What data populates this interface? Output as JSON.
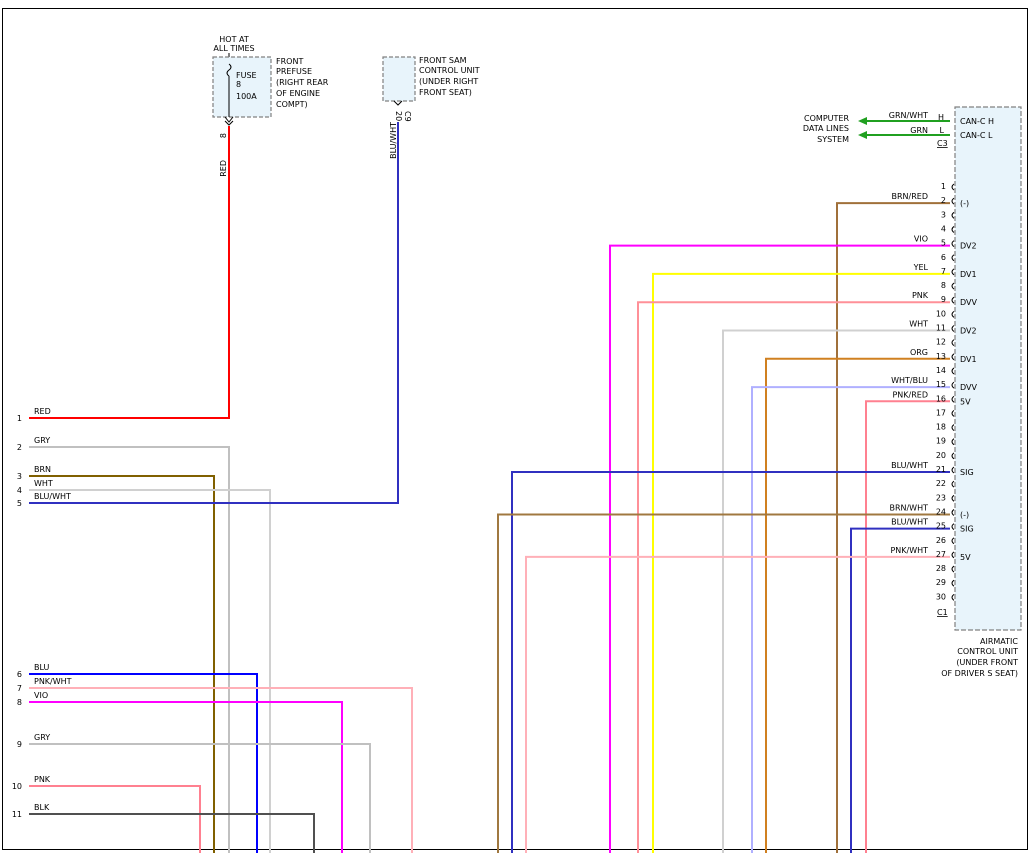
{
  "fuse_block": {
    "hot_label": [
      "HOT AT",
      "ALL TIMES"
    ],
    "fuse_label": "FUSE",
    "fuse_number": "8",
    "fuse_rating": "100A",
    "desc": [
      "FRONT",
      "PREFUSE",
      "(RIGHT REAR",
      "OF ENGINE",
      "COMPT)"
    ],
    "pin": "8",
    "wire_label": "RED"
  },
  "sam_block": {
    "desc": [
      "FRONT SAM",
      "CONTROL UNIT",
      "(UNDER RIGHT",
      "FRONT SEAT)"
    ],
    "pin": "20",
    "connector": "C9",
    "wire_label": "BLU/WHT"
  },
  "left_connector": {
    "pins": [
      {
        "num": "1",
        "label": "RED",
        "color": "#ff0000"
      },
      {
        "num": "2",
        "label": "GRY",
        "color": "#c0c0c0"
      },
      {
        "num": "3",
        "label": "BRN",
        "color": "#806000"
      },
      {
        "num": "4",
        "label": "WHT",
        "color": "#d0d0d0"
      },
      {
        "num": "5",
        "label": "BLU/WHT",
        "color": "#3030c0"
      },
      {
        "num": "6",
        "label": "BLU",
        "color": "#0000ff"
      },
      {
        "num": "7",
        "label": "PNK/WHT",
        "color": "#ffb0b8"
      },
      {
        "num": "8",
        "label": "VIO",
        "color": "#ff00ff"
      },
      {
        "num": "9",
        "label": "GRY",
        "color": "#c0c0c0"
      },
      {
        "num": "10",
        "label": "PNK",
        "color": "#ff8090"
      },
      {
        "num": "11",
        "label": "BLK",
        "color": "#505050"
      }
    ]
  },
  "airmatic": {
    "desc": [
      "AIRMATIC",
      "CONTROL UNIT",
      "(UNDER FRONT",
      "OF DRIVER S SEAT)"
    ],
    "connector_c3": "C3",
    "connector_c1": "C1",
    "can_pins": [
      {
        "pin": "H",
        "wire": "GRN/WHT",
        "func": "CAN-C H"
      },
      {
        "pin": "L",
        "wire": "GRN",
        "func": "CAN-C L"
      }
    ],
    "can_system": [
      "COMPUTER",
      "DATA LINES",
      "SYSTEM"
    ],
    "pins": [
      {
        "num": "1",
        "wire": "",
        "func": ""
      },
      {
        "num": "2",
        "wire": "BRN/RED",
        "func": "(-)",
        "color": "#a0703a"
      },
      {
        "num": "3",
        "wire": "",
        "func": ""
      },
      {
        "num": "4",
        "wire": "",
        "func": ""
      },
      {
        "num": "5",
        "wire": "VIO",
        "func": "DV2",
        "color": "#ff00ff"
      },
      {
        "num": "6",
        "wire": "",
        "func": ""
      },
      {
        "num": "7",
        "wire": "YEL",
        "func": "DV1",
        "color": "#ffff00"
      },
      {
        "num": "8",
        "wire": "",
        "func": ""
      },
      {
        "num": "9",
        "wire": "PNK",
        "func": "DVV",
        "color": "#ff9098"
      },
      {
        "num": "10",
        "wire": "",
        "func": ""
      },
      {
        "num": "11",
        "wire": "WHT",
        "func": "DV2",
        "color": "#d0d0d0"
      },
      {
        "num": "12",
        "wire": "",
        "func": ""
      },
      {
        "num": "13",
        "wire": "ORG",
        "func": "DV1",
        "color": "#d08020"
      },
      {
        "num": "14",
        "wire": "",
        "func": ""
      },
      {
        "num": "15",
        "wire": "WHT/BLU",
        "func": "DVV",
        "color": "#b0b0ff"
      },
      {
        "num": "16",
        "wire": "PNK/RED",
        "func": "5V",
        "color": "#ff8090"
      },
      {
        "num": "17",
        "wire": "",
        "func": ""
      },
      {
        "num": "18",
        "wire": "",
        "func": ""
      },
      {
        "num": "19",
        "wire": "",
        "func": ""
      },
      {
        "num": "20",
        "wire": "",
        "func": ""
      },
      {
        "num": "21",
        "wire": "BLU/WHT",
        "func": "SIG",
        "color": "#3030c0"
      },
      {
        "num": "22",
        "wire": "",
        "func": ""
      },
      {
        "num": "23",
        "wire": "",
        "func": ""
      },
      {
        "num": "24",
        "wire": "BRN/WHT",
        "func": "(-)",
        "color": "#a07840"
      },
      {
        "num": "25",
        "wire": "BLU/WHT",
        "func": "SIG",
        "color": "#3030c0"
      },
      {
        "num": "26",
        "wire": "",
        "func": ""
      },
      {
        "num": "27",
        "wire": "PNK/WHT",
        "func": "5V",
        "color": "#ffb0b8"
      },
      {
        "num": "28",
        "wire": "",
        "func": ""
      },
      {
        "num": "29",
        "wire": "",
        "func": ""
      },
      {
        "num": "30",
        "wire": "",
        "func": ""
      }
    ]
  },
  "colors": {
    "red": "#ff0000",
    "blu_wht": "#3030c0",
    "grn": "#20a020",
    "box_fill": "#e8f4fb",
    "box_stroke": "#808080"
  }
}
